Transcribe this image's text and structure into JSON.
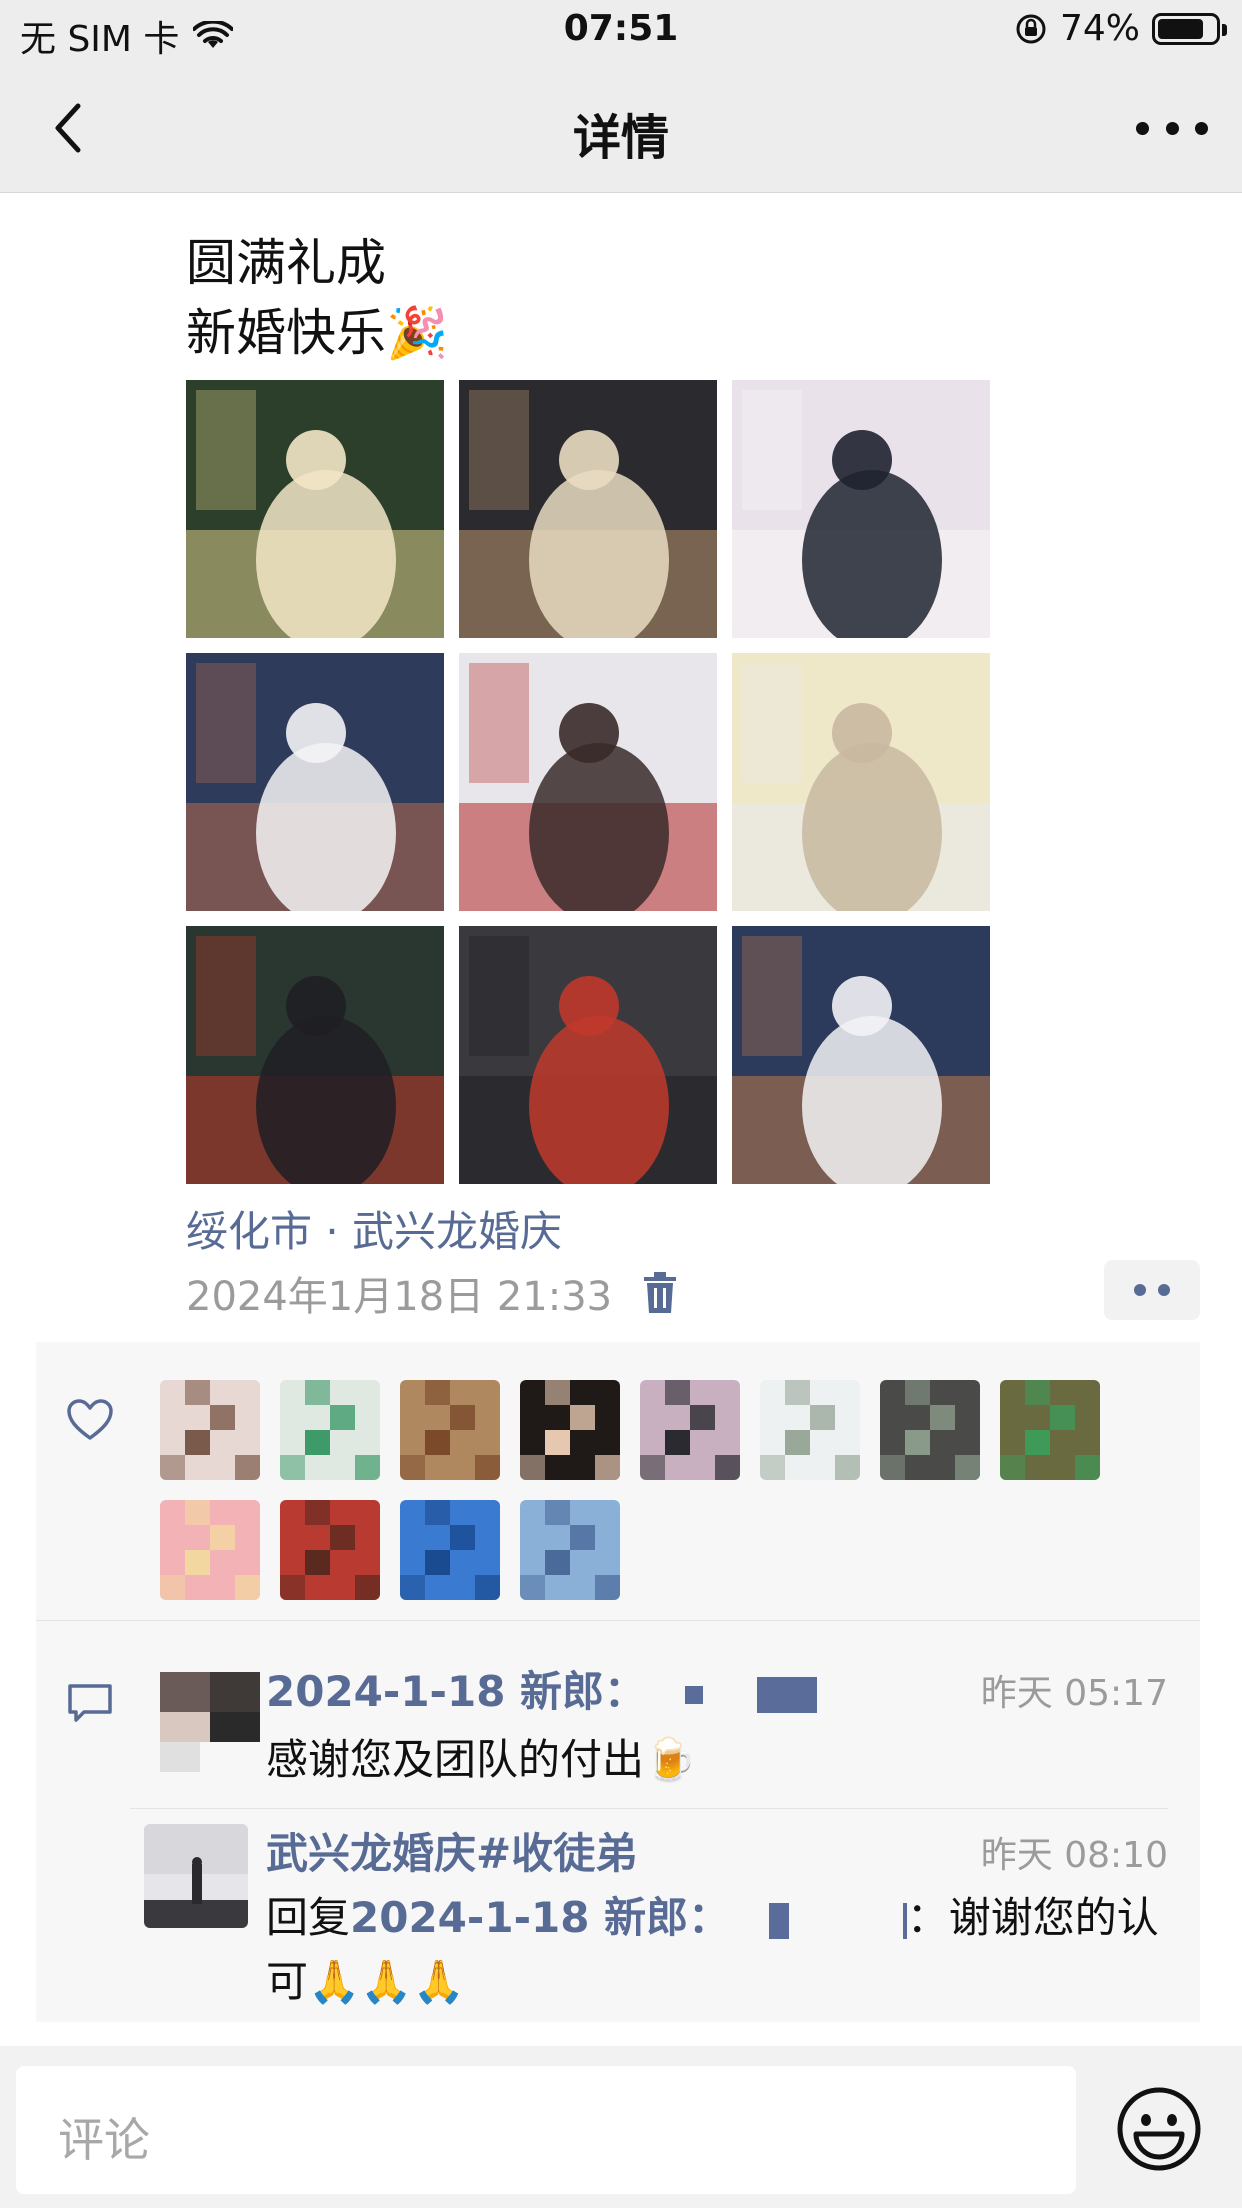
{
  "status_bar": {
    "carrier": "无 SIM 卡",
    "time": "07:51",
    "battery": "74%",
    "battery_level": 0.74
  },
  "nav": {
    "title": "详情"
  },
  "post": {
    "line1": "圆满礼成",
    "line2": "新婚快乐🎉",
    "photos": [
      {
        "name": "photo-1",
        "colors": [
          "#2c3f2a",
          "#d9c98a",
          "#f3e6c7"
        ]
      },
      {
        "name": "photo-2",
        "colors": [
          "#2b2a2e",
          "#b89470",
          "#e9dcc1"
        ]
      },
      {
        "name": "photo-3",
        "colors": [
          "#e9e2ea",
          "#f7f5f6",
          "#1f2430"
        ]
      },
      {
        "name": "photo-4",
        "colors": [
          "#2f3b5a",
          "#b56a4e",
          "#f4f4f6"
        ]
      },
      {
        "name": "photo-5",
        "colors": [
          "#e8e6ea",
          "#b32a2a",
          "#3a2a2a"
        ]
      },
      {
        "name": "photo-6",
        "colors": [
          "#efe8c8",
          "#e8e8ee",
          "#c8b8a0"
        ]
      },
      {
        "name": "photo-7",
        "colors": [
          "#2a3630",
          "#c0392b",
          "#1f1f24"
        ]
      },
      {
        "name": "photo-8",
        "colors": [
          "#3a3a3e",
          "#1f1f22",
          "#c0392b"
        ]
      },
      {
        "name": "photo-9",
        "colors": [
          "#2c3a5c",
          "#c07a4a",
          "#f3f3f6"
        ]
      }
    ],
    "location": "绥化市 · 武兴龙婚庆",
    "timestamp": "2024年1月18日 21:33"
  },
  "likes": {
    "avatars": [
      {
        "c1": "#e8d8d4",
        "c2": "#7a5a4a"
      },
      {
        "c1": "#dfe9e2",
        "c2": "#3f9a6a"
      },
      {
        "c1": "#b08860",
        "c2": "#7a4a2a"
      },
      {
        "c1": "#1f1a18",
        "c2": "#e6c8b0"
      },
      {
        "c1": "#c8b0c0",
        "c2": "#2a2a30"
      },
      {
        "c1": "#eef1f2",
        "c2": "#9aa89a"
      },
      {
        "c1": "#4a4a48",
        "c2": "#8a9a8a"
      },
      {
        "c1": "#6a6a40",
        "c2": "#3f9a5a"
      },
      {
        "c1": "#f2b2b6",
        "c2": "#f2d8a0"
      },
      {
        "c1": "#b83a30",
        "c2": "#5a2a20"
      },
      {
        "c1": "#3a7ad0",
        "c2": "#1a4a90"
      },
      {
        "c1": "#8ab0d8",
        "c2": "#4a6a9a"
      }
    ]
  },
  "comments": [
    {
      "name": "2024-1-18 新郎：",
      "time": "昨天 05:17",
      "text": "感谢您及团队的付出🍺"
    },
    {
      "name": "武兴龙婚庆#收徒弟",
      "time": "昨天 08:10",
      "reply_prefix": "回复",
      "reply_to": "2024-1-18 新郎：",
      "text": "：谢谢您的认可🙏🙏🙏"
    }
  ],
  "comment_bar": {
    "placeholder": "评论"
  }
}
